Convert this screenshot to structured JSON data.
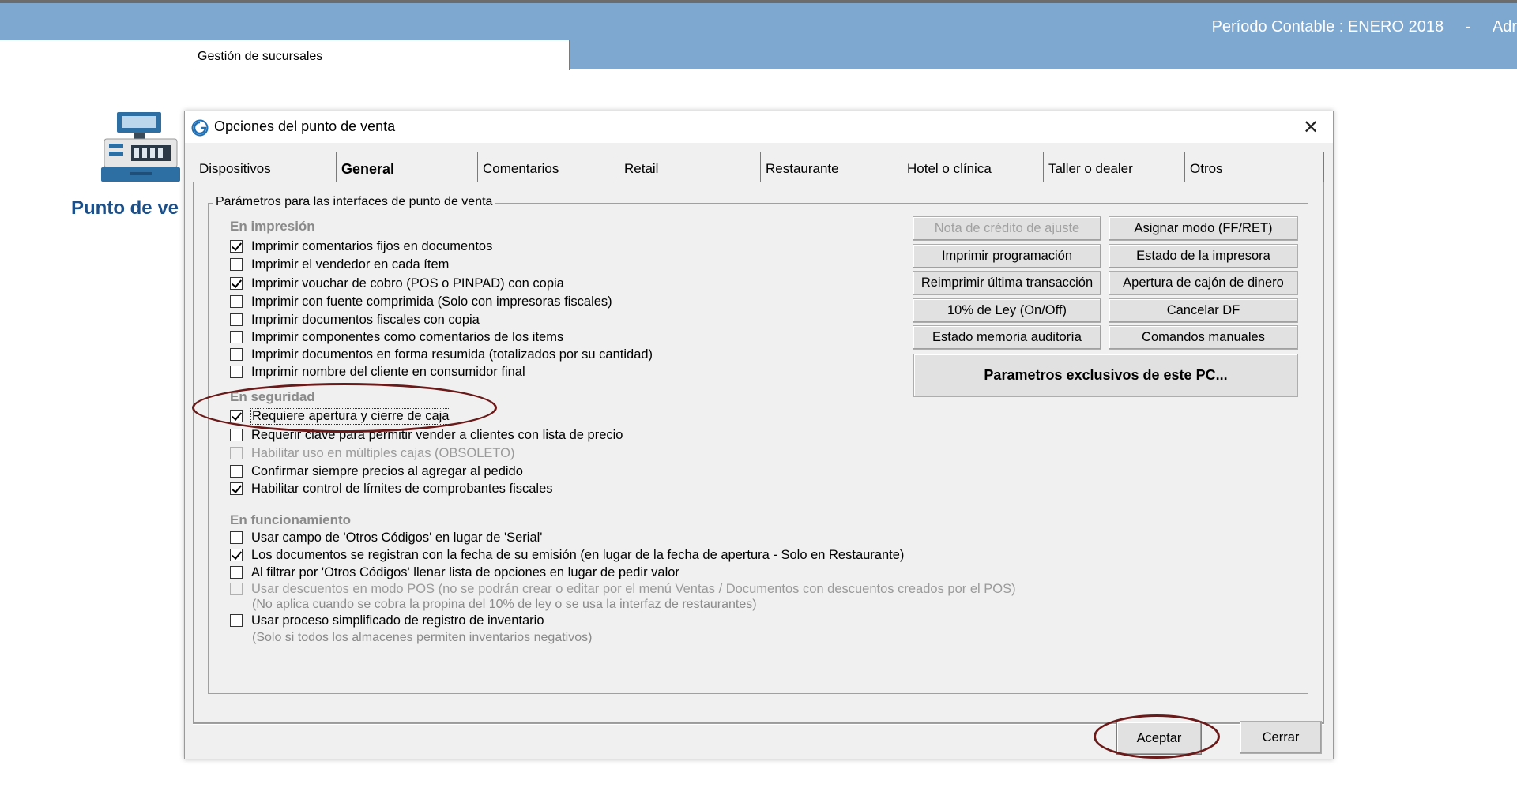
{
  "app": {
    "period_label": "Período Contable : ENERO 2018",
    "period_separator": "-",
    "user_fragment": "Adr",
    "document_tab": "Gestión de sucursales",
    "module_title": "Punto de ve"
  },
  "dialog": {
    "title": "Opciones del punto de venta",
    "close_glyph": "✕",
    "tabs": [
      {
        "label": "Dispositivos",
        "active": false
      },
      {
        "label": "General",
        "active": true
      },
      {
        "label": "Comentarios",
        "active": false
      },
      {
        "label": "Retail",
        "active": false
      },
      {
        "label": "Restaurante",
        "active": false
      },
      {
        "label": "Hotel o clínica",
        "active": false
      },
      {
        "label": "Taller o dealer",
        "active": false
      },
      {
        "label": "Otros",
        "active": false
      }
    ],
    "groupbox_label": "Parámetros para las interfaces de punto de venta",
    "sections": {
      "printing": {
        "heading": "En impresión",
        "options": [
          {
            "label": "Imprimir comentarios fijos en documentos",
            "checked": true,
            "disabled": false
          },
          {
            "label": "Imprimir el vendedor en cada ítem",
            "checked": false,
            "disabled": false
          },
          {
            "label": "Imprimir vouchar de cobro (POS  o PINPAD) con copia",
            "checked": true,
            "disabled": false
          },
          {
            "label": "Imprimir con fuente comprimida (Solo con impresoras fiscales)",
            "checked": false,
            "disabled": false
          },
          {
            "label": "Imprimir documentos fiscales con copia",
            "checked": false,
            "disabled": false
          },
          {
            "label": "Imprimir componentes como comentarios de los items",
            "checked": false,
            "disabled": false
          },
          {
            "label": "Imprimir documentos en forma resumida (totalizados por su cantidad)",
            "checked": false,
            "disabled": false
          },
          {
            "label": "Imprimir nombre del cliente en consumidor final",
            "checked": false,
            "disabled": false
          }
        ]
      },
      "security": {
        "heading": "En seguridad",
        "options": [
          {
            "label": "Requiere apertura y cierre de caja",
            "checked": true,
            "disabled": false
          },
          {
            "label": "Requerir clave para permitir vender a clientes con lista de precio",
            "checked": false,
            "disabled": false
          },
          {
            "label": "Habilitar uso en múltiples cajas (OBSOLETO)",
            "checked": false,
            "disabled": true
          },
          {
            "label": "Confirmar siempre precios al agregar al pedido",
            "checked": false,
            "disabled": false
          },
          {
            "label": "Habilitar control de límites de comprobantes fiscales",
            "checked": true,
            "disabled": false
          }
        ]
      },
      "operation": {
        "heading": "En funcionamiento",
        "options": [
          {
            "label": "Usar campo de 'Otros Códigos' en lugar de 'Serial'",
            "checked": false,
            "disabled": false
          },
          {
            "label": "Los documentos se registran con la fecha de su emisión (en lugar de la fecha de apertura - Solo en Restaurante)",
            "checked": true,
            "disabled": false
          },
          {
            "label": "Al filtrar por 'Otros Códigos' llenar lista de opciones en lugar de pedir valor",
            "checked": false,
            "disabled": false
          },
          {
            "label": "Usar descuentos en modo POS (no se podrán crear o editar por el menú Ventas / Documentos con descuentos creados por el POS)",
            "checked": false,
            "disabled": true
          },
          {
            "label": "Usar proceso simplificado de registro de inventario",
            "checked": false,
            "disabled": false
          }
        ],
        "notes": [
          "(No aplica cuando se cobra la propina del 10% de ley o se usa la interfaz de restaurantes)",
          "(Solo si todos los almacenes permiten inventarios negativos)"
        ]
      }
    },
    "buttons": {
      "nota_credito": "Nota de crédito de ajuste",
      "asignar_modo": "Asignar modo (FF/RET)",
      "imprimir_programacion": "Imprimir programación",
      "estado_impresora": "Estado de la impresora",
      "reimprimir": "Reimprimir última transacción",
      "apertura_cajon": "Apertura de cajón de dinero",
      "ley_10": "10% de Ley (On/Off)",
      "cancelar_df": "Cancelar DF",
      "estado_memoria": "Estado memoria auditoría",
      "comandos_manuales": "Comandos manuales",
      "parametros_pc": "Parametros exclusivos de este PC..."
    },
    "footer": {
      "accept": "Aceptar",
      "close": "Cerrar"
    }
  },
  "colors": {
    "banner": "#7fa8d0",
    "annotation": "#6b1a1a",
    "module_title": "#1d4f86"
  }
}
